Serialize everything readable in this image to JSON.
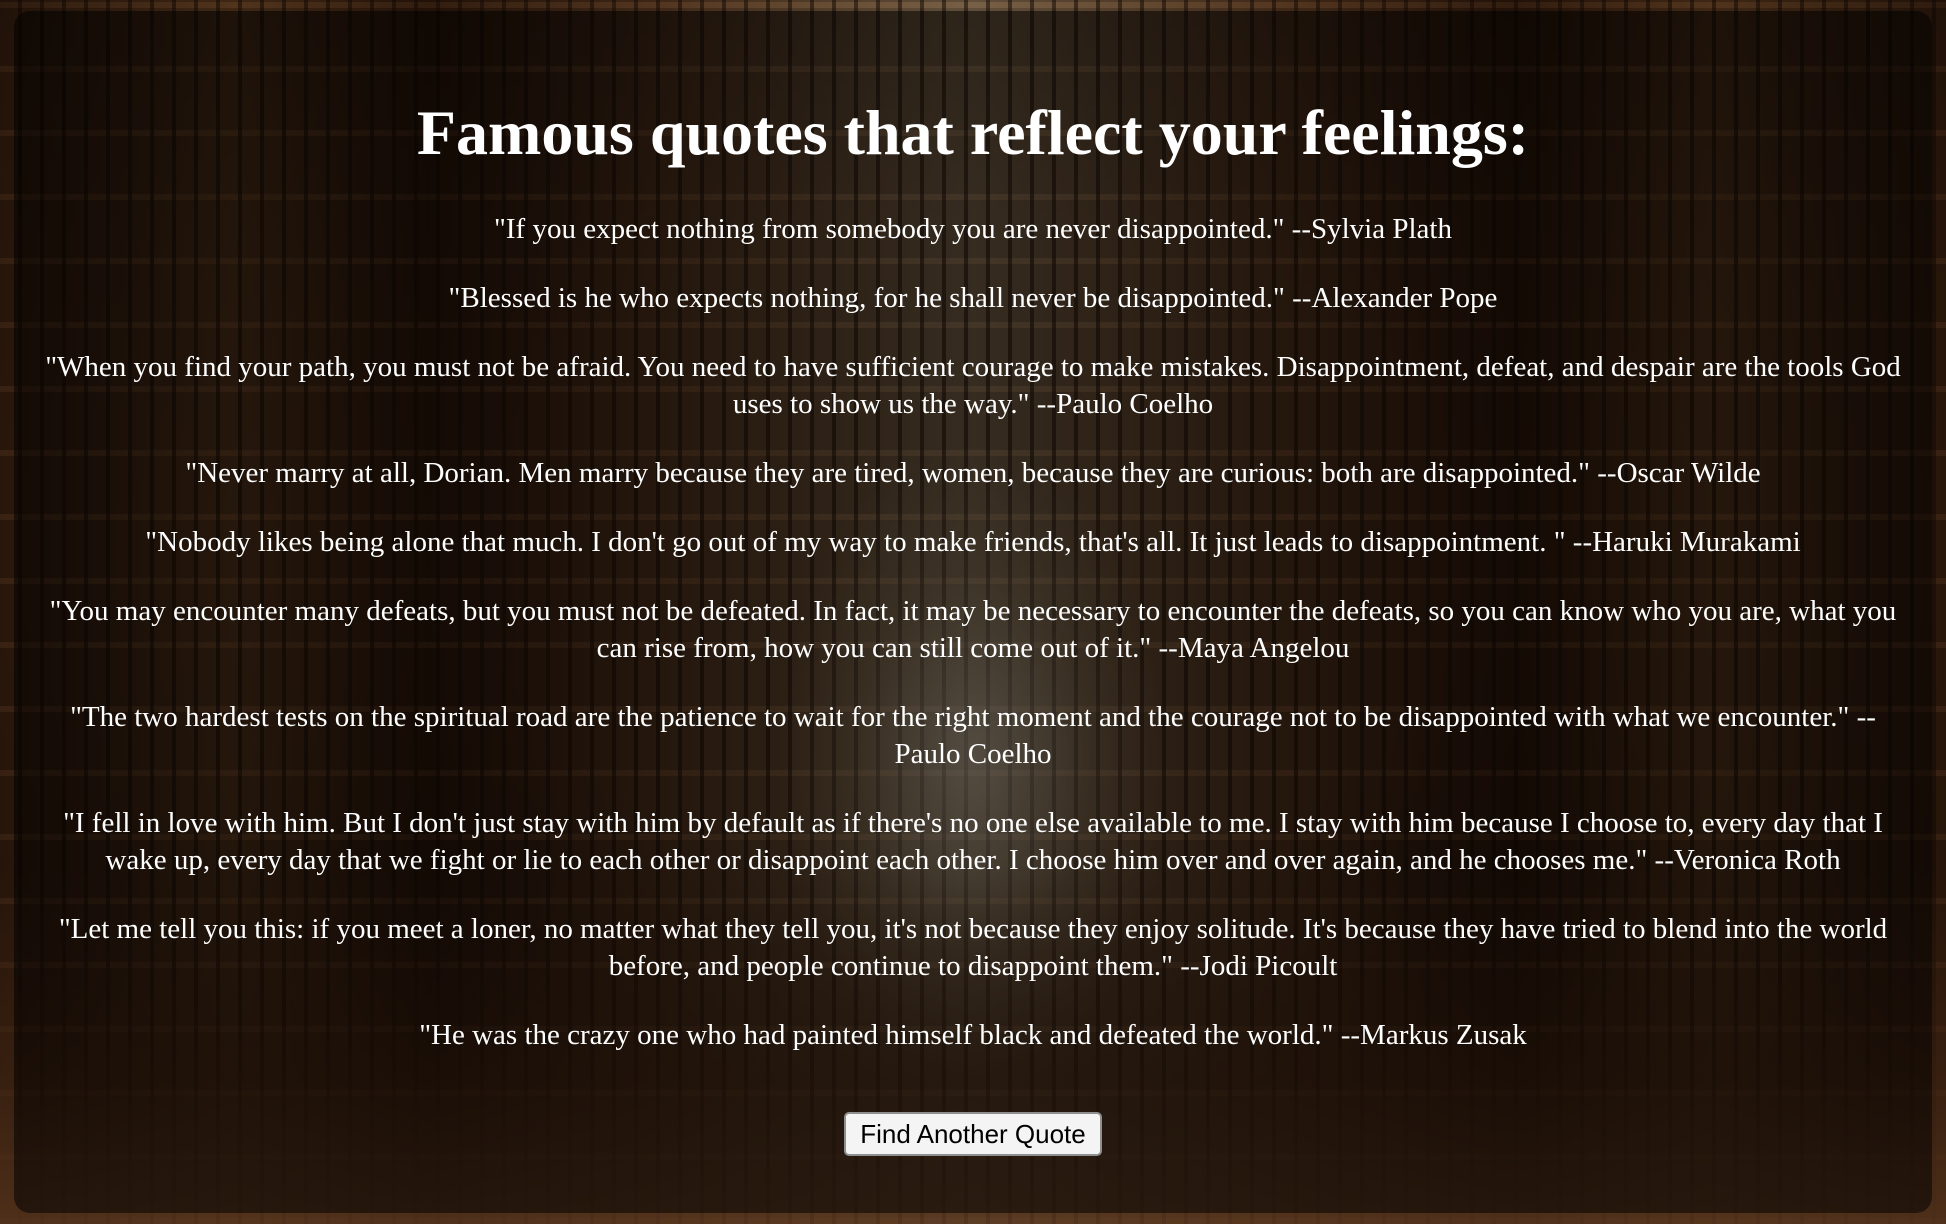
{
  "page": {
    "title": "Famous quotes that reflect your feelings:",
    "button_label": "Find Another Quote"
  },
  "quotes": [
    "\"If you expect nothing from somebody you are never disappointed.\" --Sylvia Plath",
    "\"Blessed is he who expects nothing, for he shall never be disappointed.\" --Alexander Pope",
    "\"When you find your path, you must not be afraid. You need to have sufficient courage to make mistakes. Disappointment, defeat, and despair are the tools God uses to show us the way.\" --Paulo Coelho",
    "\"Never marry at all, Dorian. Men marry because they are tired, women, because they are curious: both are disappointed.\" --Oscar Wilde",
    "\"Nobody likes being alone that much. I don't go out of my way to make friends, that's all. It just leads to disappointment. \" --Haruki Murakami",
    "\"You may encounter many defeats, but you must not be defeated. In fact, it may be necessary to encounter the defeats, so you can know who you are, what you can rise from, how you can still come out of it.\" --Maya Angelou",
    "\"The two hardest tests on the spiritual road are the patience to wait for the right moment and the courage not to be disappointed with what we encounter.\" --Paulo Coelho",
    "\"I fell in love with him. But I don't just stay with him by default as if there's no one else available to me. I stay with him because I choose to, every day that I wake up, every day that we fight or lie to each other or disappoint each other. I choose him over and over again, and he chooses me.\" --Veronica Roth",
    "\"Let me tell you this: if you meet a loner, no matter what they tell you, it's not because they enjoy solitude. It's because they have tried to blend into the world before, and people continue to disappoint them.\" --Jodi Picoult",
    "\"He was the crazy one who had painted himself black and defeated the world.\" --Markus Zusak"
  ]
}
